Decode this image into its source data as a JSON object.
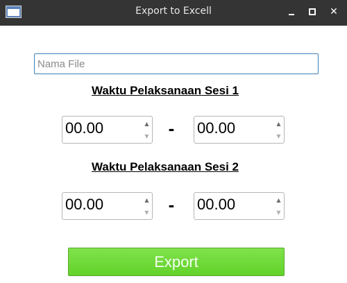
{
  "window": {
    "title": "Export to Excell"
  },
  "form": {
    "filename_placeholder": "Nama File",
    "filename_value": "",
    "session1": {
      "label": "Waktu Pelaksanaan Sesi 1",
      "start": "00.00",
      "separator": "-",
      "end": "00.00"
    },
    "session2": {
      "label": "Waktu Pelaksanaan Sesi 2",
      "start": "00.00",
      "separator": "-",
      "end": "00.00"
    },
    "export_label": "Export"
  },
  "icons": {
    "spin_up": "▲",
    "spin_down": "▼"
  },
  "colors": {
    "titlebar": "#343434",
    "focus_border": "#3f80b5",
    "export_button": "#6fd93a"
  }
}
